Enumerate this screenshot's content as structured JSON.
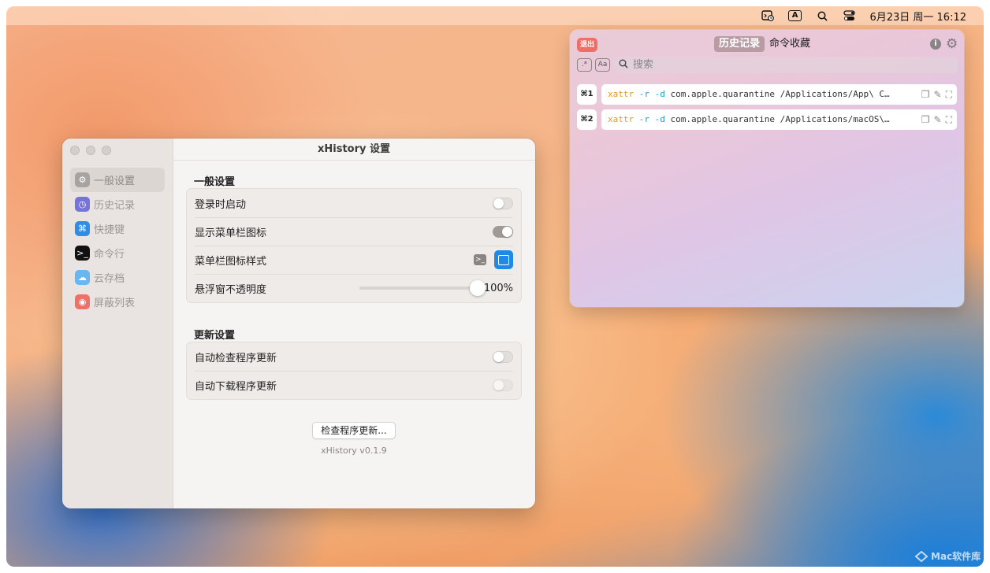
{
  "menubar": {
    "app_icon": "terminal-clock-icon",
    "input_method": "A",
    "datetime": "6月23日 周一  16:12"
  },
  "settings": {
    "title": "xHistory 设置",
    "sidebar": [
      {
        "label": "一般设置",
        "icon": "gear-icon",
        "color": "#9e9a98",
        "active": true
      },
      {
        "label": "历史记录",
        "icon": "clock-icon",
        "color": "#6f6cd8"
      },
      {
        "label": "快捷键",
        "icon": "command-icon",
        "color": "#2f8de4"
      },
      {
        "label": "命令行",
        "icon": "terminal-icon",
        "color": "#111111"
      },
      {
        "label": "云存档",
        "icon": "cloud-icon",
        "color": "#5fb0f0"
      },
      {
        "label": "屏蔽列表",
        "icon": "eye-slash-icon",
        "color": "#ee6f65"
      }
    ],
    "general": {
      "header": "一般设置",
      "launch_at_login": {
        "label": "登录时启动",
        "on": false
      },
      "show_menubar_icon": {
        "label": "显示菜单栏图标",
        "on": true
      },
      "menubar_icon_style": {
        "label": "菜单栏图标样式"
      },
      "panel_opacity": {
        "label": "悬浮窗不透明度",
        "value": "100%",
        "fraction": 1.0
      }
    },
    "update": {
      "header": "更新设置",
      "auto_check": {
        "label": "自动检查程序更新",
        "on": false
      },
      "auto_download": {
        "label": "自动下载程序更新",
        "on": false,
        "disabled": true
      }
    },
    "check_button": "检查程序更新...",
    "version": "xHistory v0.1.9"
  },
  "panel": {
    "exit_label": "退出",
    "tabs": [
      "历史记录",
      "命令收藏"
    ],
    "active_tab": 0,
    "regex_label": ".*",
    "case_label": "Aa",
    "search_placeholder": "搜索",
    "history": [
      {
        "key": "⌘1",
        "cmd": "xattr",
        "flags": "-r -d",
        "rest": " com.apple.quarantine /Applications/App\\ C…"
      },
      {
        "key": "⌘2",
        "cmd": "xattr",
        "flags": "-r -d",
        "rest": " com.apple.quarantine /Applications/macOS\\…"
      }
    ]
  },
  "watermark": "Mac软件库"
}
